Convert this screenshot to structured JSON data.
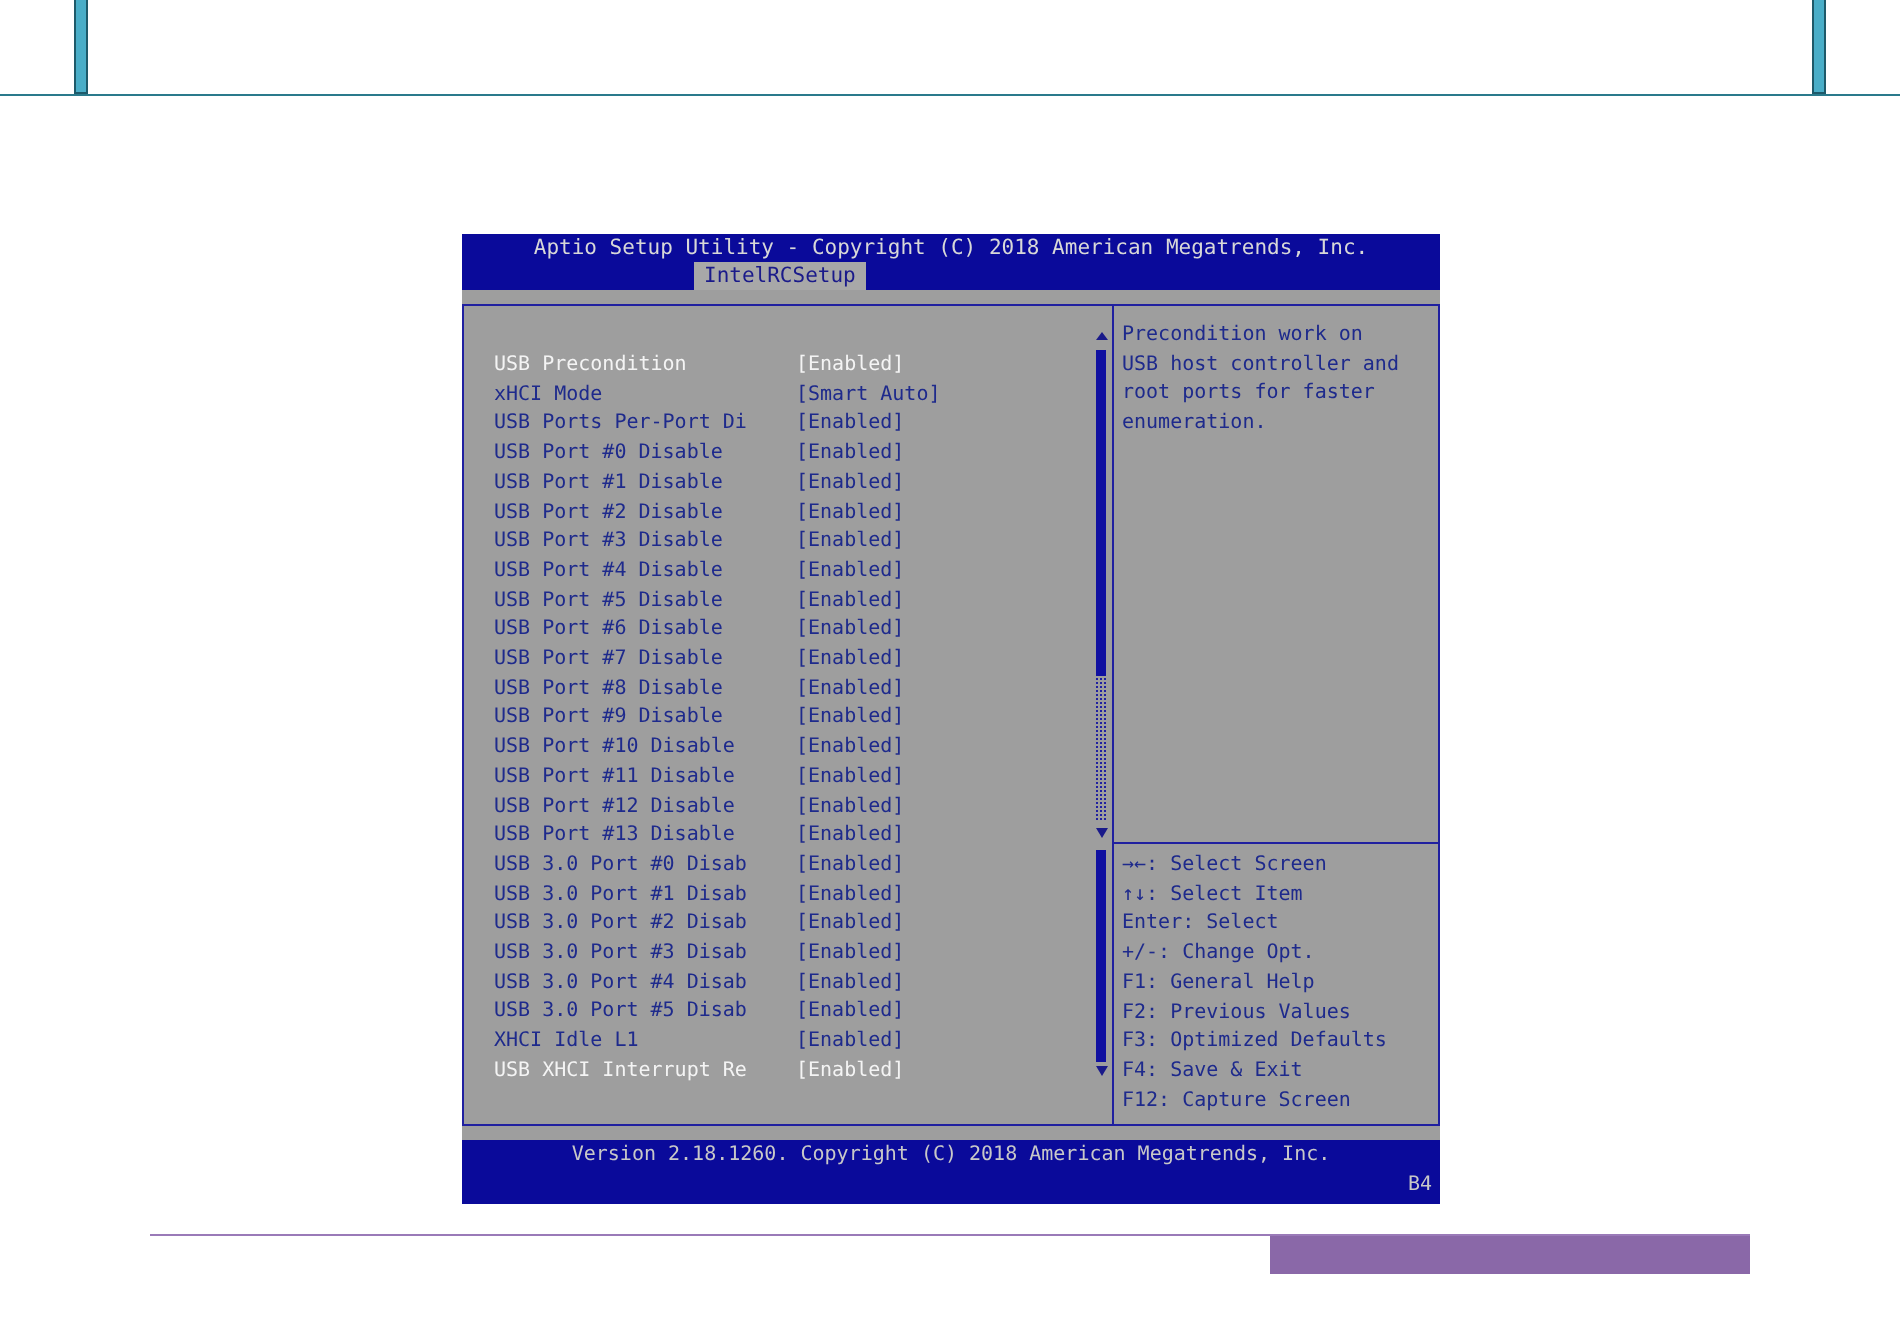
{
  "header": {
    "title": "Aptio Setup Utility - Copyright (C) 2018 American Megatrends, Inc.",
    "tabs": [
      {
        "label": "IntelRCSetup",
        "selected": true
      }
    ]
  },
  "settings": [
    {
      "label": "USB Precondition",
      "value": "[Enabled]",
      "highlighted": true
    },
    {
      "label": "xHCI Mode",
      "value": "[Smart Auto]",
      "highlighted": false
    },
    {
      "label": "USB Ports Per-Port Di",
      "value": "[Enabled]",
      "highlighted": false
    },
    {
      "label": "USB Port #0 Disable",
      "value": "[Enabled]",
      "highlighted": false
    },
    {
      "label": "USB Port #1 Disable",
      "value": "[Enabled]",
      "highlighted": false
    },
    {
      "label": "USB Port #2 Disable",
      "value": "[Enabled]",
      "highlighted": false
    },
    {
      "label": "USB Port #3 Disable",
      "value": "[Enabled]",
      "highlighted": false
    },
    {
      "label": "USB Port #4 Disable",
      "value": "[Enabled]",
      "highlighted": false
    },
    {
      "label": "USB Port #5 Disable",
      "value": "[Enabled]",
      "highlighted": false
    },
    {
      "label": "USB Port #6 Disable",
      "value": "[Enabled]",
      "highlighted": false
    },
    {
      "label": "USB Port #7 Disable",
      "value": "[Enabled]",
      "highlighted": false
    },
    {
      "label": "USB Port #8 Disable",
      "value": "[Enabled]",
      "highlighted": false
    },
    {
      "label": "USB Port #9 Disable",
      "value": "[Enabled]",
      "highlighted": false
    },
    {
      "label": "USB Port #10 Disable",
      "value": "[Enabled]",
      "highlighted": false
    },
    {
      "label": "USB Port #11 Disable",
      "value": "[Enabled]",
      "highlighted": false
    },
    {
      "label": "USB Port #12 Disable",
      "value": "[Enabled]",
      "highlighted": false
    },
    {
      "label": "USB Port #13 Disable",
      "value": "[Enabled]",
      "highlighted": false
    },
    {
      "label": "USB 3.0 Port #0 Disab",
      "value": "[Enabled]",
      "highlighted": false
    },
    {
      "label": "USB 3.0 Port #1 Disab",
      "value": "[Enabled]",
      "highlighted": false
    },
    {
      "label": "USB 3.0 Port #2 Disab",
      "value": "[Enabled]",
      "highlighted": false
    },
    {
      "label": "USB 3.0 Port #3 Disab",
      "value": "[Enabled]",
      "highlighted": false
    },
    {
      "label": "USB 3.0 Port #4 Disab",
      "value": "[Enabled]",
      "highlighted": false
    },
    {
      "label": "USB 3.0 Port #5 Disab",
      "value": "[Enabled]",
      "highlighted": false
    },
    {
      "label": "XHCI Idle L1",
      "value": "[Enabled]",
      "highlighted": false
    },
    {
      "label": "USB XHCI Interrupt Re",
      "value": "[Enabled]",
      "highlighted": true
    }
  ],
  "help_text": "Precondition work on USB host controller and root ports for faster enumeration.",
  "key_help": [
    "→←: Select Screen",
    "↑↓: Select Item",
    "Enter: Select",
    "+/-: Change Opt.",
    "F1: General Help",
    "F2: Previous Values",
    "F3: Optimized Defaults",
    "F4: Save & Exit",
    "F12: Capture Screen"
  ],
  "footer": {
    "version": "Version 2.18.1260. Copyright (C) 2018 American Megatrends, Inc.",
    "code": "B4"
  }
}
